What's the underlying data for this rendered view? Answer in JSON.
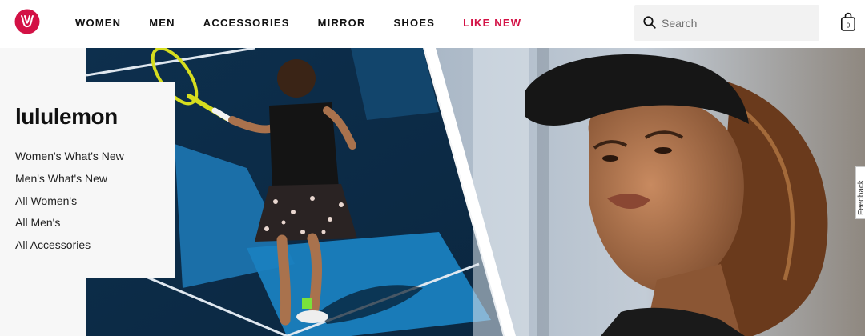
{
  "header": {
    "nav": [
      "WOMEN",
      "MEN",
      "ACCESSORIES",
      "MIRROR",
      "SHOES",
      "LIKE NEW"
    ],
    "search": {
      "placeholder": "Search"
    }
  },
  "hero": {
    "brand": "lululemon",
    "links": [
      "Women's What's New",
      "Men's What's New",
      "All Women's",
      "All Men's",
      "All Accessories"
    ]
  },
  "feedback_tab": "Feedback",
  "colors": {
    "brand_red": "#d31145",
    "court_blue": "#1e78b4",
    "court_dark": "#0e2d4a"
  },
  "icons": [
    "lululemon-logo-icon",
    "search-icon",
    "shopping-bag-icon"
  ]
}
